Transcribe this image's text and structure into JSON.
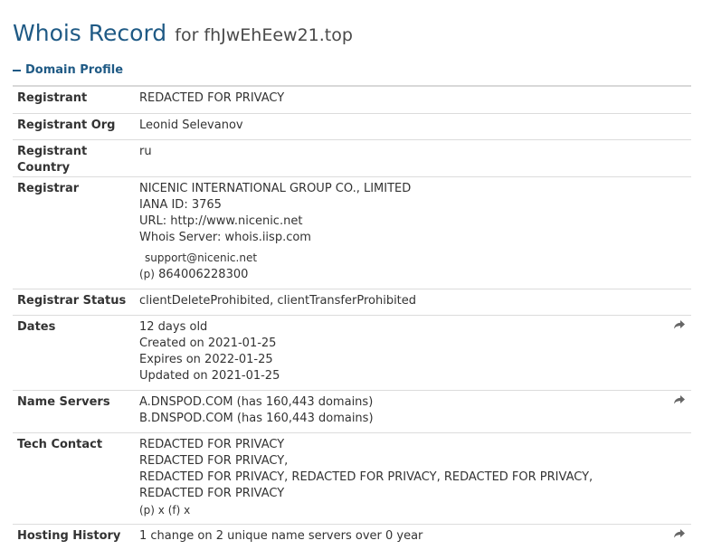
{
  "header": {
    "title": "Whois Record",
    "subtitle": "for fhJwEhEew21.top"
  },
  "section": {
    "toggle_label": "Domain Profile"
  },
  "rows": {
    "registrant": {
      "label": "Registrant",
      "value": "REDACTED FOR PRIVACY"
    },
    "registrant_org": {
      "label": "Registrant Org",
      "value": "Leonid Selevanov"
    },
    "registrant_country": {
      "label": "Registrant Country",
      "value": "ru"
    },
    "registrar": {
      "label": "Registrar",
      "name": "NICENIC INTERNATIONAL GROUP CO., LIMITED",
      "iana": "IANA ID: 3765",
      "url": "URL: http://www.nicenic.net",
      "whois_server": "Whois Server: whois.iisp.com",
      "email": "support@nicenic.net",
      "phone_prefix": "(p)",
      "phone": "864006228300"
    },
    "registrar_status": {
      "label": "Registrar Status",
      "value": "clientDeleteProhibited, clientTransferProhibited"
    },
    "dates": {
      "label": "Dates",
      "age": "12 days old",
      "created": "Created on 2021-01-25",
      "expires": "Expires on 2022-01-25",
      "updated": "Updated on 2021-01-25"
    },
    "name_servers": {
      "label": "Name Servers",
      "ns1": "A.DNSPOD.COM (has 160,443 domains)",
      "ns2": "B.DNSPOD.COM (has 160,443 domains)"
    },
    "tech_contact": {
      "label": "Tech Contact",
      "line1": "REDACTED FOR PRIVACY",
      "line2": "REDACTED FOR PRIVACY,",
      "line3": "REDACTED FOR PRIVACY, REDACTED FOR PRIVACY, REDACTED FOR PRIVACY, REDACTED FOR PRIVACY",
      "phone_fax": "(p)  x  (f)  x"
    },
    "hosting_history": {
      "label": "Hosting History",
      "value": "1 change on 2 unique name servers over 0 year"
    }
  },
  "icons": {
    "share": "share-arrow-icon",
    "collapse": "minus-icon"
  },
  "colors": {
    "title": "#1f5a85",
    "border": "#dcdcdc",
    "text": "#333333"
  }
}
